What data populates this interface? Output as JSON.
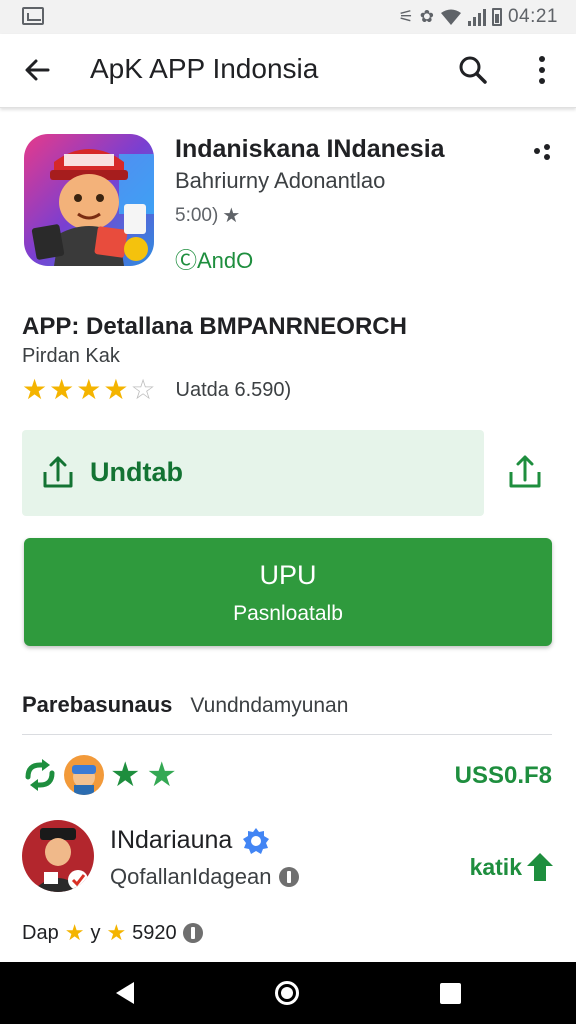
{
  "status_bar": {
    "time": "04:21"
  },
  "toolbar": {
    "title": "ApK APP Indonsia"
  },
  "app_card": {
    "name": "Indaniskana INdanesia",
    "developer": "Bahriurny Adonantlao",
    "rating": "5:00)",
    "tag": "ⒸAndO"
  },
  "details": {
    "title": "APP: Detallana BMPANRNEORCH",
    "subtitle": "Pirdan Kak",
    "stars": 4,
    "stars_total": 5,
    "count": "Uatda 6.590)"
  },
  "download": {
    "label": "Undtab"
  },
  "install": {
    "main": "UPU",
    "sub": "Pasnloatalb"
  },
  "tabs": {
    "active": "Parebasunaus",
    "other": "Vundndamyunan"
  },
  "badge_row": {
    "price": "USS0.F8"
  },
  "user": {
    "name": "INdariauna",
    "subtitle": "QofallanIdagean",
    "action": "katik"
  },
  "footer": {
    "text_a": "Dap",
    "text_b": "y",
    "value": "5920"
  },
  "colors": {
    "brand_green": "#2f9a3d",
    "text_green": "#1e8e3e",
    "light_green": "#e6f4ea",
    "star": "#f4b400"
  }
}
